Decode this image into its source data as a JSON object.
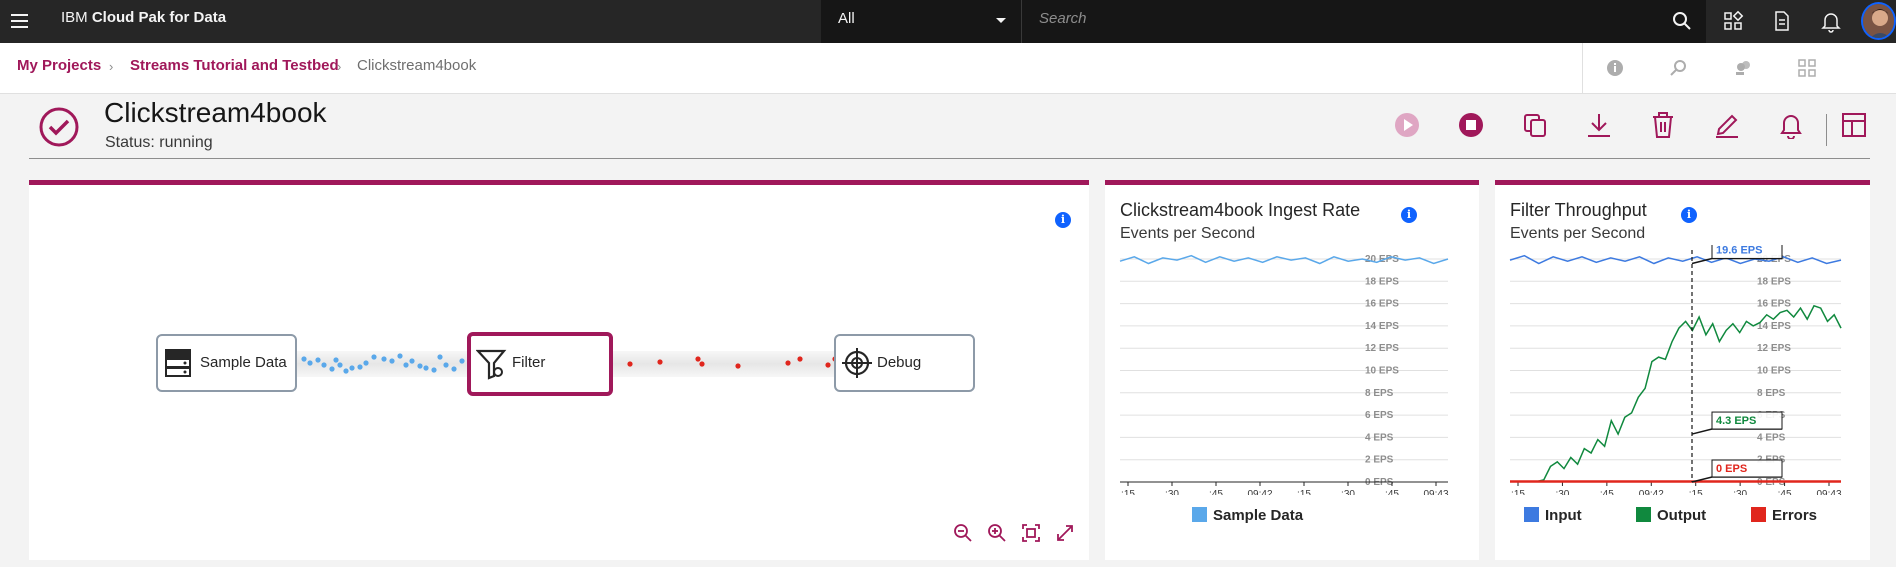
{
  "nav": {
    "brand_prefix": "IBM",
    "brand_name": "Cloud Pak for Data",
    "scope_value": "All",
    "search_placeholder": "Search"
  },
  "breadcrumb": {
    "items": [
      "My Projects",
      "Streams Tutorial and Testbed",
      "Clickstream4book"
    ]
  },
  "job": {
    "title": "Clickstream4book",
    "status": "Status: running"
  },
  "colors": {
    "brand": "#a0185a",
    "input": "#3d7ae0",
    "output": "#10893e",
    "errors": "#e0261d",
    "sample": "#5aa8ea"
  },
  "graph": {
    "nodes": [
      {
        "label": "Sample Data",
        "icon": "database-icon"
      },
      {
        "label": "Filter",
        "icon": "filter-icon"
      },
      {
        "label": "Debug",
        "icon": "crosshair-icon"
      }
    ]
  },
  "ingest_chart": {
    "title": "Clickstream4book Ingest Rate",
    "subtitle": "Events per Second",
    "chart_data": {
      "type": "line",
      "y_ticks": [
        "20 EPS",
        "18 EPS",
        "16 EPS",
        "14 EPS",
        "12 EPS",
        "10 EPS",
        "8 EPS",
        "6 EPS",
        "4 EPS",
        "2 EPS",
        "0 EPS"
      ],
      "ylim": [
        0,
        20
      ],
      "x_ticks": [
        ":15",
        ":30",
        ":45",
        "09:42",
        ":15",
        ":30",
        ":45",
        "09:43"
      ],
      "series": [
        {
          "name": "Sample Data",
          "color": "#5aa8ea",
          "values": [
            19.8,
            20.2,
            19.6,
            20.1,
            19.9,
            20.3,
            19.7,
            20.2,
            19.8,
            20.1,
            19.7,
            20.2,
            19.9,
            20.1,
            19.6,
            20.2,
            19.8,
            20.0,
            19.7,
            20.2,
            19.9,
            20.1,
            19.6,
            20.0
          ]
        }
      ],
      "grid": true,
      "legend": "bottom"
    }
  },
  "filter_chart": {
    "title": "Filter Throughput",
    "subtitle": "Events per Second",
    "tooltips": [
      "19.6 EPS",
      "4.3 EPS",
      "0 EPS"
    ],
    "chart_data": {
      "type": "line",
      "y_ticks": [
        "20 EPS",
        "18 EPS",
        "16 EPS",
        "14 EPS",
        "12 EPS",
        "10 EPS",
        "8 EPS",
        "6 EPS",
        "4 EPS",
        "2 EPS",
        "0 EPS"
      ],
      "ylim": [
        0,
        20
      ],
      "x_ticks": [
        ":15",
        ":30",
        ":45",
        "09:42",
        ":15",
        ":30",
        ":45",
        "09:43"
      ],
      "series": [
        {
          "name": "Input",
          "color": "#3d7ae0",
          "values": [
            19.9,
            20.3,
            19.6,
            20.2,
            19.8,
            20.2,
            19.7,
            20.1,
            19.8,
            20.2,
            19.6,
            20.1,
            19.8,
            20.2,
            19.7,
            20.1,
            19.6,
            20.0,
            19.8,
            20.2,
            19.7,
            20.1,
            19.6,
            19.9
          ]
        },
        {
          "name": "Output",
          "color": "#10893e",
          "values": [
            0,
            0,
            0,
            0,
            0,
            0.2,
            1.4,
            1.8,
            1.2,
            2.2,
            1.6,
            3.0,
            2.6,
            3.8,
            3.2,
            5.5,
            4.3,
            5.8,
            6.2,
            7.6,
            8.4,
            10.8,
            11.2,
            11.0,
            12.6,
            13.8,
            14.4,
            13.6,
            14.8,
            13.2,
            14.2,
            12.6,
            13.6,
            14.2,
            13.4,
            14.4,
            14.0,
            14.3,
            15.0,
            14.6,
            15.2,
            15.4,
            14.8,
            15.6,
            14.6,
            15.8,
            15.6,
            14.4,
            15.0,
            13.8
          ]
        },
        {
          "name": "Errors",
          "color": "#e0261d",
          "values": [
            0,
            0,
            0,
            0,
            0,
            0,
            0,
            0,
            0,
            0,
            0,
            0,
            0,
            0,
            0,
            0,
            0,
            0,
            0,
            0,
            0,
            0,
            0,
            0
          ]
        }
      ],
      "grid": true,
      "legend": "bottom"
    }
  }
}
